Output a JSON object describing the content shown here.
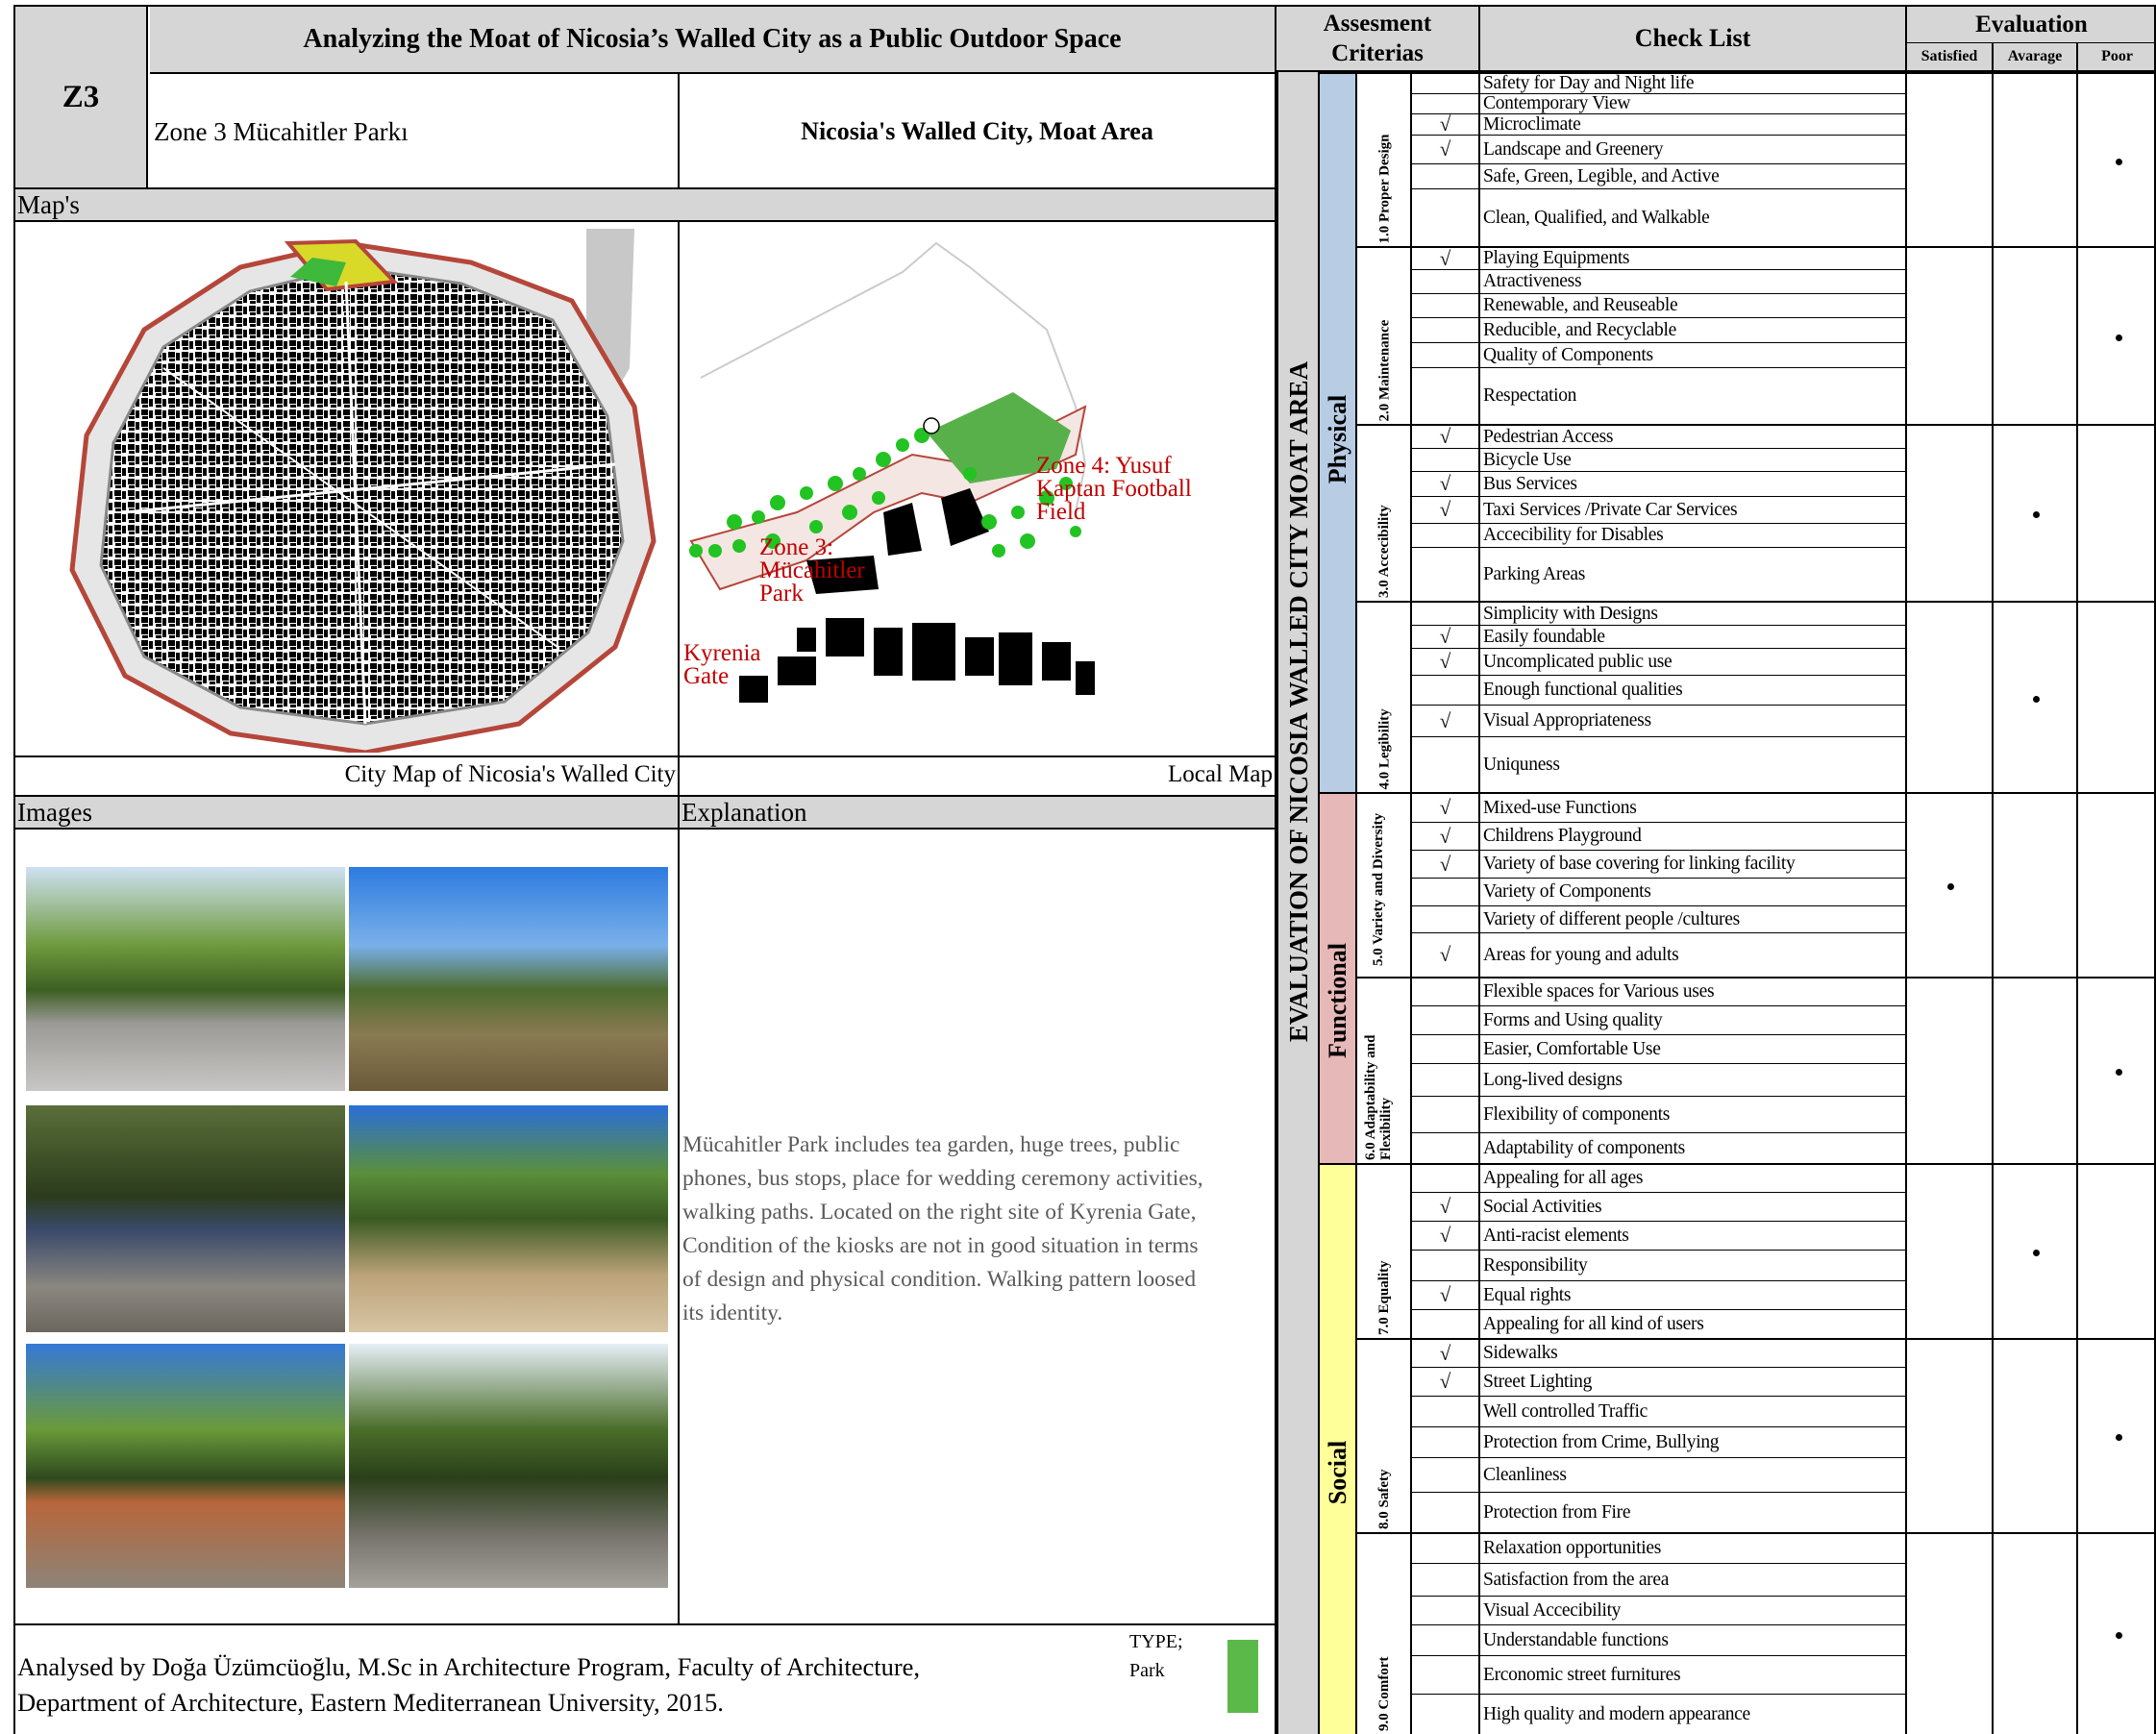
{
  "header": {
    "title": "Analyzing the Moat of Nicosia’s Walled City as a Public Outdoor Space",
    "zone_code": "Z3",
    "zone_name": "Zone 3 Mücahitler Parkı",
    "area_name": "Nicosia's Walled City, Moat Area",
    "assessment_label": "Assesment Criterias",
    "checklist_label": "Check List",
    "evaluation_label": "Evaluation",
    "eval_columns": [
      "Satisfied",
      "Avarage",
      "Poor"
    ]
  },
  "maps": {
    "section_label": "Map's",
    "city_map_caption": "City Map of Nicosia's Walled City",
    "local_map_caption": "Local Map",
    "local_map_labels": {
      "zone4": [
        "Zone 4: Yusuf",
        "Kaptan Football",
        "Field"
      ],
      "zone3": [
        "Zone 3:",
        "Mücahitler",
        "Park"
      ],
      "gate": [
        "Kyrenia",
        "Gate"
      ]
    }
  },
  "images": {
    "section_label": "Images"
  },
  "explanation": {
    "section_label": "Explanation",
    "lines": [
      "Mücahitler Park includes tea garden, huge trees, public",
      "phones, bus stops, place for wedding ceremony activities,",
      "walking paths. Located on the right site of Kyrenia Gate,",
      "Condition of the kiosks are not in good situation in terms",
      "of design and physical condition. Walking pattern loosed",
      "its identity."
    ]
  },
  "footer": {
    "line1": "Analysed by Doğa Üzümcüoğlu, M.Sc in Architecture Program, Faculty of Architecture,",
    "line2": "Department of Architecture, Eastern Mediterranean University, 2015.",
    "type_label": "TYPE;",
    "type_value": "Park",
    "type_color": "#5bb94a"
  },
  "evaluation": {
    "vertical_title": "EVALUATION OF NICOSIA WALLED CITY MOAT AREA",
    "check_mark": "√",
    "groups": [
      {
        "name": "Physical",
        "color": "#b8cce4"
      },
      {
        "name": "Functional",
        "color": "#e6b8b7"
      },
      {
        "name": "Social",
        "color": "#ffff99"
      }
    ],
    "criteria": [
      {
        "name": "1.0 Proper Design",
        "rating": "Poor",
        "items": [
          {
            "text": "Safety for Day and Night life",
            "checked": false
          },
          {
            "text": "Contemporary View",
            "checked": false
          },
          {
            "text": "Microclimate",
            "checked": true
          },
          {
            "text": "Landscape and Greenery",
            "checked": true
          },
          {
            "text": "Safe, Green, Legible, and Active",
            "checked": false
          },
          {
            "text": "Clean, Qualified, and Walkable",
            "checked": false
          }
        ]
      },
      {
        "name": "2.0 Maintenance",
        "rating": "Poor",
        "items": [
          {
            "text": "Playing Equipments",
            "checked": true
          },
          {
            "text": "Atractiveness",
            "checked": false
          },
          {
            "text": "Renewable, and Reuseable",
            "checked": false
          },
          {
            "text": "Reducible, and Recyclable",
            "checked": false
          },
          {
            "text": "Quality of Components",
            "checked": false
          },
          {
            "text": "Respectation",
            "checked": false
          }
        ]
      },
      {
        "name": "3.0 Accecibility",
        "rating": "Avarage",
        "items": [
          {
            "text": "Pedestrian Access",
            "checked": true
          },
          {
            "text": "Bicycle Use",
            "checked": false
          },
          {
            "text": "Bus Services",
            "checked": true
          },
          {
            "text": "Taxi Services /Private Car Services",
            "checked": true
          },
          {
            "text": "Accecibility for Disables",
            "checked": false
          },
          {
            "text": "Parking Areas",
            "checked": false
          }
        ]
      },
      {
        "name": "4.0 Legibility",
        "rating": "Avarage",
        "items": [
          {
            "text": "Simplicity with Designs",
            "checked": false
          },
          {
            "text": "Easily foundable",
            "checked": true
          },
          {
            "text": "Uncomplicated public use",
            "checked": true
          },
          {
            "text": "Enough functional qualities",
            "checked": false
          },
          {
            "text": "Visual Appropriateness",
            "checked": true
          },
          {
            "text": "Uniquness",
            "checked": false
          }
        ]
      },
      {
        "name": "5.0 Variety and Diversity",
        "rating": "Satisfied",
        "items": [
          {
            "text": "Mixed-use Functions",
            "checked": true
          },
          {
            "text": "Childrens Playground",
            "checked": true
          },
          {
            "text": "Variety of base covering for linking facility",
            "checked": true
          },
          {
            "text": "Variety of Components",
            "checked": false
          },
          {
            "text": "Variety of different people /cultures",
            "checked": false
          },
          {
            "text": "Areas for young and adults",
            "checked": true
          }
        ]
      },
      {
        "name": "6.0 Adaptability and Flexibility",
        "rating": "Poor",
        "items": [
          {
            "text": "Flexible spaces for Various uses",
            "checked": false
          },
          {
            "text": "Forms and Using quality",
            "checked": false
          },
          {
            "text": "Easier, Comfortable Use",
            "checked": false
          },
          {
            "text": "Long-lived designs",
            "checked": false
          },
          {
            "text": "Flexibility of components",
            "checked": false
          },
          {
            "text": "Adaptability of components",
            "checked": false
          }
        ]
      },
      {
        "name": "7.0 Equality",
        "rating": "Avarage",
        "items": [
          {
            "text": "Appealing for all ages",
            "checked": false
          },
          {
            "text": "Social Activities",
            "checked": true
          },
          {
            "text": "Anti-racist elements",
            "checked": true
          },
          {
            "text": "Responsibility",
            "checked": false
          },
          {
            "text": "Equal rights",
            "checked": true
          },
          {
            "text": "Appealing for all kind of users",
            "checked": false
          }
        ]
      },
      {
        "name": "8.0 Safety",
        "rating": "Poor",
        "items": [
          {
            "text": "Sidewalks",
            "checked": true
          },
          {
            "text": "Street Lighting",
            "checked": true
          },
          {
            "text": "Well controlled Traffic",
            "checked": false
          },
          {
            "text": "Protection from Crime, Bullying",
            "checked": false
          },
          {
            "text": "Cleanliness",
            "checked": false
          },
          {
            "text": "Protection from Fire",
            "checked": false
          }
        ]
      },
      {
        "name": "9.0 Comfort",
        "rating": "Poor",
        "items": [
          {
            "text": "Relaxation opportunities",
            "checked": false
          },
          {
            "text": "Satisfaction from the area",
            "checked": false
          },
          {
            "text": "Visual Accecibility",
            "checked": false
          },
          {
            "text": "Understandable functions",
            "checked": false
          },
          {
            "text": "Erconomic street furnitures",
            "checked": false
          },
          {
            "text": "High quality and modern appearance",
            "checked": false
          }
        ]
      }
    ]
  }
}
